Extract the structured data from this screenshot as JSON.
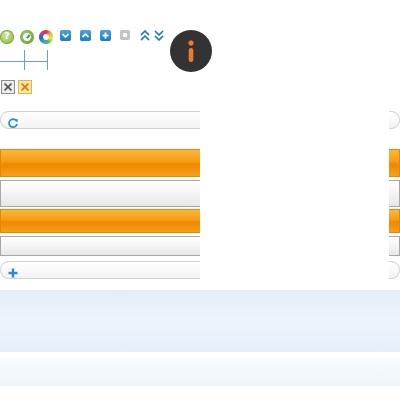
{
  "icons": {
    "help": "help-icon",
    "clock": "clock-icon",
    "color": "color-wheel-icon",
    "down": "arrow-down-square-icon",
    "up": "arrow-up-square-icon",
    "add": "plus-square-icon",
    "gray": "gray-square-icon",
    "double_up": "double-chevron-up-icon",
    "double_down": "double-chevron-down-icon",
    "info": "info-icon",
    "close_gray": "close-icon",
    "close_yellow": "close-hover-icon",
    "refresh": "refresh-icon",
    "plus": "plus-icon"
  },
  "colors": {
    "accent_blue": "#1f7cc2",
    "orange": "#f59c10",
    "info_bg": "#333333",
    "info_fg": "#f07a2a",
    "band": "#e2eef9"
  },
  "toolbar": {
    "help_glyph": "?"
  }
}
